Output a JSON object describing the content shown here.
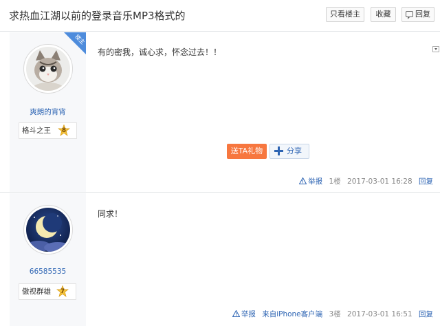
{
  "thread": {
    "title": "求热血江湖以前的登录音乐MP3格式的",
    "buttons": {
      "only_op": "只看楼主",
      "collect": "收藏",
      "reply": "回复"
    }
  },
  "posts": [
    {
      "op_badge": "楼主",
      "username": "爽朗的宵宵",
      "rank_title": "格斗之王",
      "rank_level": "8",
      "content": "有的密我，诚心求，怀念过去！！",
      "gift_label": "送TA礼物",
      "share_label": "分享",
      "report_label": "举报",
      "floor": "1楼",
      "time": "2017-03-01 16:28",
      "reply_label": "回复"
    },
    {
      "username": "66585535",
      "rank_title": "傲视群雄",
      "rank_level": "7",
      "content": "同求！",
      "report_label": "举报",
      "source": "来自iPhone客户端",
      "floor": "3楼",
      "time": "2017-03-01 16:51",
      "reply_label": "回复"
    }
  ],
  "colors": {
    "link": "#2d64b3",
    "gift": "#f7773f",
    "op_badge": "#4e8cdc",
    "sidebar_bg": "#f7f8fa"
  },
  "icons": [
    "kitten-avatar",
    "moon-avatar",
    "star-badge-icon",
    "plus-icon",
    "warning-icon",
    "reply-icon",
    "menu-caret-icon"
  ]
}
